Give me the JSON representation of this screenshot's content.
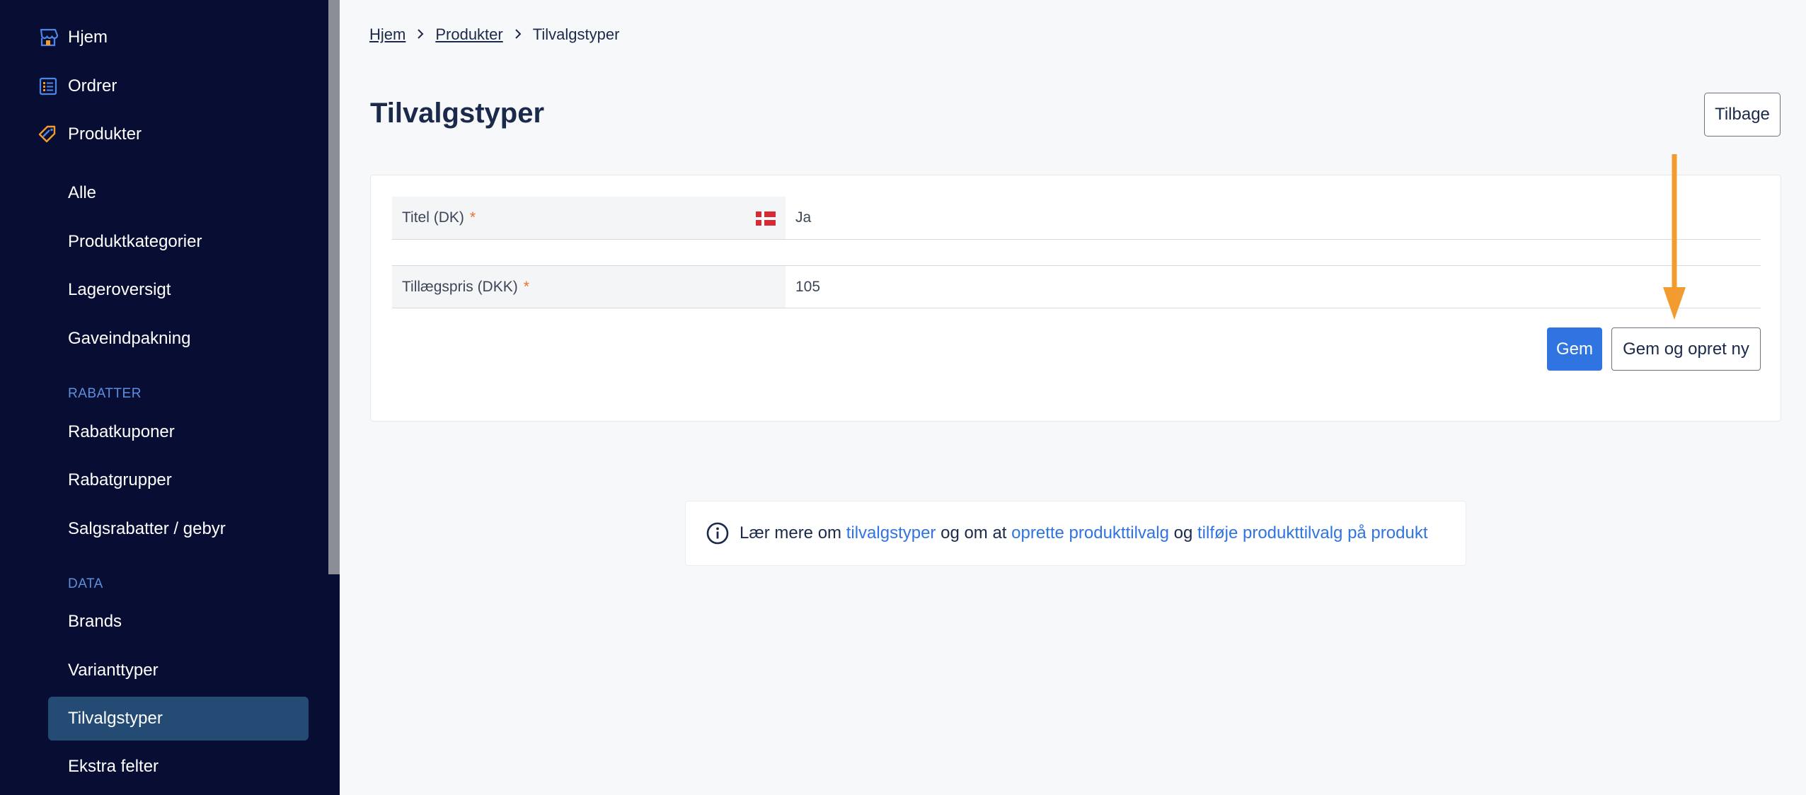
{
  "sidebar": {
    "top_items": [
      {
        "label": "Hjem",
        "icon": "store-icon"
      },
      {
        "label": "Ordrer",
        "icon": "orders-list-icon"
      },
      {
        "label": "Produkter",
        "icon": "tag-icon"
      }
    ],
    "product_items": [
      "Alle",
      "Produktkategorier",
      "Lageroversigt",
      "Gaveindpakning"
    ],
    "section_discounts": "RABATTER",
    "discount_items": [
      "Rabatkuponer",
      "Rabatgrupper",
      "Salgsrabatter / gebyr"
    ],
    "section_data": "DATA",
    "data_items": [
      "Brands",
      "Varianttyper",
      "Tilvalgstyper",
      "Ekstra felter"
    ],
    "active_item": "Tilvalgstyper"
  },
  "breadcrumb": {
    "items": [
      "Hjem",
      "Produkter"
    ],
    "current": "Tilvalgstyper"
  },
  "page": {
    "title": "Tilvalgstyper",
    "back_label": "Tilbage"
  },
  "form": {
    "fields": [
      {
        "label": "Titel (DK)",
        "required_mark": "*",
        "value": "Ja",
        "flag": "danish-flag"
      },
      {
        "label": "Tillægspris (DKK)",
        "required_mark": "*",
        "value": "105"
      }
    ],
    "save_label": "Gem",
    "save_new_label": "Gem og opret ny"
  },
  "info": {
    "text_1": "Lær mere om ",
    "link_1": "tilvalgstyper",
    "text_2": " og om at ",
    "link_2": "oprette produkttilvalg",
    "text_3": " og ",
    "link_3": "tilføje produkttilvalg på produkt"
  },
  "colors": {
    "sidebar_bg": "#070d33",
    "active_bg": "#234b73",
    "accent": "#2f74e0",
    "arrow": "#f29b2f",
    "required": "#e8722c"
  }
}
